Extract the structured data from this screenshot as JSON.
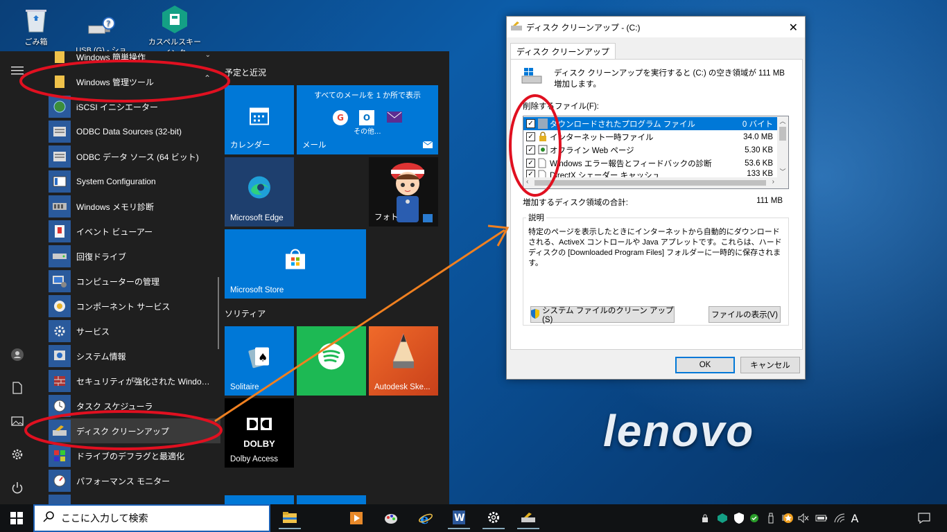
{
  "desktop": {
    "icons": [
      {
        "name": "recycle-bin-icon",
        "label": "ごみ箱"
      },
      {
        "name": "usb-shortcut-icon",
        "label": "USB (G) - ショートカ"
      },
      {
        "name": "kaspersky-icon",
        "label": "カスペルスキー インタ"
      }
    ],
    "brand": "lenovo"
  },
  "start_menu": {
    "apps": [
      {
        "label": "Windows 簡単操作",
        "type": "folder"
      },
      {
        "label": "Windows 管理ツール",
        "type": "folder"
      },
      {
        "label": "iSCSI イニシエーター"
      },
      {
        "label": "ODBC Data Sources (32-bit)"
      },
      {
        "label": "ODBC データ ソース (64 ビット)"
      },
      {
        "label": "System Configuration"
      },
      {
        "label": "Windows メモリ診断"
      },
      {
        "label": "イベント ビューアー"
      },
      {
        "label": "回復ドライブ"
      },
      {
        "label": "コンピューターの管理"
      },
      {
        "label": "コンポーネント サービス"
      },
      {
        "label": "サービス"
      },
      {
        "label": "システム情報"
      },
      {
        "label": "セキュリティが強化された Windows De..."
      },
      {
        "label": "タスク スケジューラ"
      },
      {
        "label": "ディスク クリーンアップ"
      },
      {
        "label": "ドライブのデフラグと最適化"
      },
      {
        "label": "パフォーマンス モニター"
      }
    ],
    "groups": {
      "recent": "予定と近況",
      "solitaire": "ソリティア"
    },
    "tiles": {
      "calendar": "カレンダー",
      "mail": "メール",
      "mail_header": "すべてのメールを 1 か所で表示",
      "mail_more": "その他...",
      "edge": "Microsoft Edge",
      "photos": "フォト",
      "store": "Microsoft Store",
      "solitaire": "Solitaire",
      "autodesk": "Autodesk Ske...",
      "dolby": "Dolby Access",
      "dolby_logo": "DOLBY"
    }
  },
  "dialog": {
    "title": "ディスク クリーンアップ - (C:)",
    "close": "✕",
    "tab": "ディスク クリーンアップ",
    "intro": "ディスク クリーンアップを実行すると (C:) の空き領域が 111 MB 増加します。",
    "files_label": "削除するファイル(F):",
    "files": [
      {
        "name": "ダウンロードされたプログラム ファイル",
        "size": "0 バイト",
        "checked": true,
        "selected": true
      },
      {
        "name": "インターネット一時ファイル",
        "size": "34.0 MB",
        "checked": true
      },
      {
        "name": "オフライン Web ページ",
        "size": "5.30 KB",
        "checked": true
      },
      {
        "name": "Windows エラー報告とフィードバックの診断",
        "size": "53.6 KB",
        "checked": true
      },
      {
        "name": "DirectX シェーダー キャッシュ",
        "size": "133 KB",
        "checked": true
      }
    ],
    "total_label": "増加するディスク領域の合計:",
    "total_value": "111 MB",
    "desc_label": "説明",
    "desc_text": "特定のページを表示したときにインターネットから自動的にダウンロードされる、ActiveX コントロールや Java アプレットです。これらは、ハード ディスクの [Downloaded Program Files] フォルダーに一時的に保存されます。",
    "sys_btn": "システム ファイルのクリーン アップ(S)",
    "view_btn": "ファイルの表示(V)",
    "ok": "OK",
    "cancel": "キャンセル"
  },
  "taskbar": {
    "search_placeholder": "ここに入力して検索",
    "ime": "A"
  },
  "colors": {
    "accent": "#0078d7",
    "annotation_red": "#e01020",
    "annotation_orange": "#f08020"
  }
}
